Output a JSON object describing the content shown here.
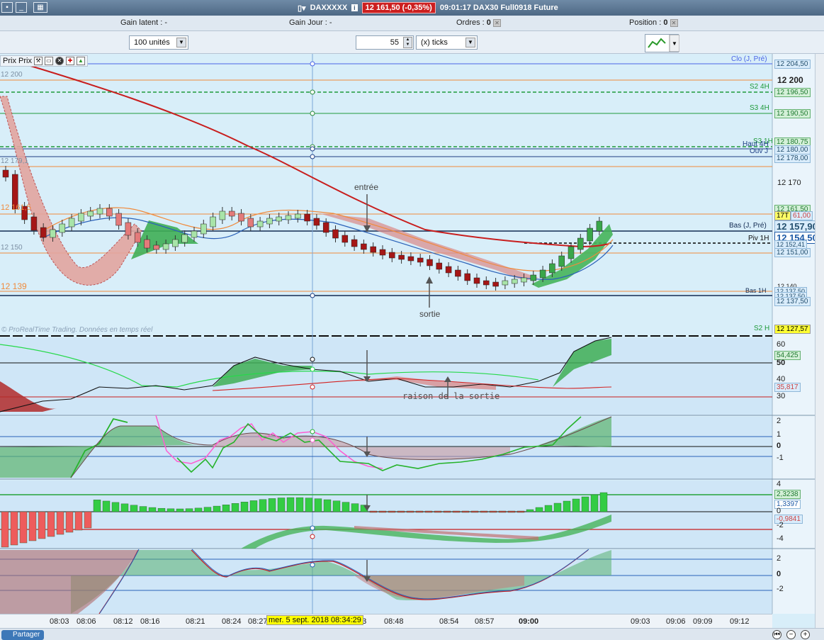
{
  "window": {
    "symbol": "DAXXXXX",
    "price_badge": "12 161,50 (-0,35%)",
    "status": "09:01:17 DAX30 Full0918 Future"
  },
  "info": {
    "gain_latent_label": "Gain latent :",
    "gain_latent_value": "-",
    "gain_jour_label": "Gain Jour :",
    "gain_jour_value": "-",
    "ordres_label": "Ordres :",
    "ordres_value": "0",
    "position_label": "Position :",
    "position_value": "0"
  },
  "toolbar": {
    "quantity": "100 unités",
    "interval_value": "55",
    "interval_unit": "(x) ticks"
  },
  "chart": {
    "panel_title": "Prix Prix",
    "copyright": "© ProRealTime Trading. Données en temps réel",
    "annotations": {
      "entry": "entrée",
      "exit": "sortie",
      "exit_reason": "raison de la sortie"
    },
    "left_labels": {
      "l12200": "12 200",
      "l12179": "12 179,1",
      "l12161": "12 161,5",
      "l12150": "12 150",
      "l12139": "12 139"
    },
    "line_tags": {
      "clo": "Clo (J, Pré)",
      "s2_4h": "S2 4H",
      "s3_4h": "S3 4H",
      "s3_1h": "S3 1H",
      "haut_4h": "Haut 4H",
      "ouv_j": "Ouv J",
      "bas_j": "Bas (J, Pré)",
      "piv_1h": "Piv 1H",
      "s2_h": "S2 H",
      "bas_1h": "Bas 1H"
    },
    "price_labels": {
      "p1": "12 204,50",
      "p2": "12 200",
      "p3": "12 196,50",
      "p4": "12 190,50",
      "p5": "12 180,75",
      "p6": "12 180,00",
      "p7": "12 178,00",
      "p8": "12 170",
      "p9": "12 161,50",
      "p10": "17T",
      "p11": "61,00",
      "p12": "12 157,90",
      "p13": "12 154,50",
      "p14": "12 152,41",
      "p15": "12 151,00",
      "p16": "12 140",
      "p17": "12 137,50",
      "p18": "12 137,50",
      "p19": "12 137,50",
      "p20": "12 127,57"
    },
    "ind1_labels": {
      "a": "60",
      "b": "50",
      "c": "40",
      "d": "30",
      "v1": "54,425",
      "v2": "35,817"
    },
    "ind2_labels": {
      "a": "2",
      "b": "1",
      "c": "0",
      "d": "-1"
    },
    "ind3_labels": {
      "a": "4",
      "b": "2,3238",
      "c": "1,3397",
      "d": "0",
      "e": "-0,9841",
      "f": "-2",
      "g": "-4"
    },
    "ind4_labels": {
      "a": "2",
      "b": "0",
      "c": "-2"
    }
  },
  "time_axis": {
    "ticks": [
      "08:03",
      "08:06",
      "08:12",
      "08:16",
      "08:21",
      "08:24",
      "08:27",
      "43",
      "08:48",
      "08:54",
      "08:57",
      "09:00",
      "09:03",
      "09:06",
      "09:09",
      "09:12"
    ],
    "cursor_date": "mer. 5 sept. 2018 08:34:29"
  },
  "footer": {
    "share_label": "Partager"
  },
  "colors": {
    "bull": "#3aa64a",
    "bear": "#a51616",
    "ma_red": "#c81e1e",
    "background": "#d8eef9"
  }
}
